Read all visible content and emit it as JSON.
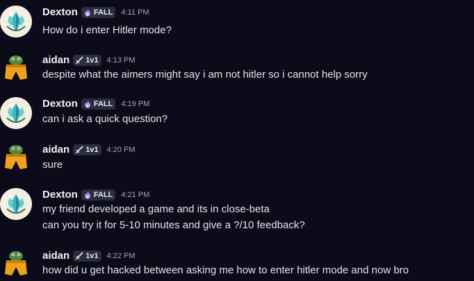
{
  "messages": [
    {
      "user": "Dexton",
      "tag": "FALL",
      "tag_icon": "flame-icon",
      "time": "4:11 PM",
      "avatar": "crystal-avatar",
      "lines": [
        "How do i enter Hitler mode?"
      ]
    },
    {
      "user": "aidan",
      "tag": "1v1",
      "tag_icon": "sword-icon",
      "time": "4:13 PM",
      "avatar": "frog-avatar",
      "lines": [
        "despite what the aimers might say i am not hitler so i cannot help sorry"
      ]
    },
    {
      "user": "Dexton",
      "tag": "FALL",
      "tag_icon": "flame-icon",
      "time": "4:19 PM",
      "avatar": "crystal-avatar",
      "lines": [
        "can i ask a quick question?"
      ]
    },
    {
      "user": "aidan",
      "tag": "1v1",
      "tag_icon": "sword-icon",
      "time": "4:20 PM",
      "avatar": "frog-avatar",
      "lines": [
        "sure"
      ]
    },
    {
      "user": "Dexton",
      "tag": "FALL",
      "tag_icon": "flame-icon",
      "time": "4:21 PM",
      "avatar": "crystal-avatar",
      "lines": [
        "my friend developed a game and its in close-beta",
        "can you try it for 5-10 minutes and give a ?/10 feedback?"
      ]
    },
    {
      "user": "aidan",
      "tag": "1v1",
      "tag_icon": "sword-icon",
      "time": "4:22 PM",
      "avatar": "frog-avatar",
      "lines": [
        "how did u get hacked between asking me how to enter hitler mode and now bro"
      ]
    }
  ],
  "colors": {
    "background": "#0b0b1a",
    "username": "#f2f3f5",
    "message_text": "#e4e5ea",
    "timestamp": "#a5a7b2",
    "tag_background": "#2b2c3d",
    "flame_icon": "#b58cf2"
  }
}
